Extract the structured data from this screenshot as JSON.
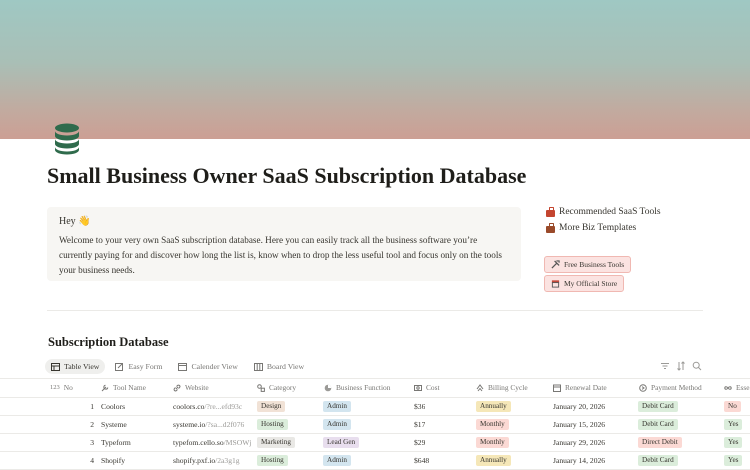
{
  "colors": {
    "tag_brown": "#f1e2d6",
    "tag_green": "#dbeddb",
    "tag_blue": "#d3e5ef",
    "tag_purple": "#e8deee",
    "tag_yellow": "#f5e7b8",
    "tag_red": "#fbd9d4",
    "tag_gray": "#e9e8e5"
  },
  "page": {
    "icon": "database-icon",
    "title": "Small Business Owner SaaS Subscription Database"
  },
  "callout": {
    "greeting": "Hey 👋",
    "body": "Welcome to your very own SaaS subscription database. Here you can easily track all the business software you’re currently paying for and discover how long the list is, know when to drop the less useful tool and focus only on the tools your business needs."
  },
  "links": [
    {
      "label": "Recommended SaaS Tools",
      "icon": "briefcase-icon"
    },
    {
      "label": "More Biz Templates",
      "icon": "briefcase-icon"
    }
  ],
  "buttons": [
    {
      "label": "Free Business Tools",
      "icon": "hammer-wrench-icon"
    },
    {
      "label": "My Official Store",
      "icon": "store-icon"
    }
  ],
  "database": {
    "title": "Subscription Database",
    "views": [
      {
        "label": "Table View",
        "icon": "table-icon",
        "active": true
      },
      {
        "label": "Easy Form",
        "icon": "pencil-icon",
        "active": false
      },
      {
        "label": "Calender View",
        "icon": "calendar-icon",
        "active": false
      },
      {
        "label": "Board View",
        "icon": "board-icon",
        "active": false
      }
    ],
    "toolbar": [
      "filter-icon",
      "sort-icon",
      "search-icon"
    ],
    "columns": [
      {
        "label": "No",
        "icon": "number-icon"
      },
      {
        "label": "Tool Name",
        "icon": "wrench-icon"
      },
      {
        "label": "Website",
        "icon": "link-icon"
      },
      {
        "label": "Category",
        "icon": "shapes-icon"
      },
      {
        "label": "Business Function",
        "icon": "pie-icon"
      },
      {
        "label": "Cost",
        "icon": "money-icon"
      },
      {
        "label": "Billing Cycle",
        "icon": "cycle-icon"
      },
      {
        "label": "Renewal Date",
        "icon": "calendar-icon"
      },
      {
        "label": "Payment Method",
        "icon": "card-icon"
      },
      {
        "label": "Esse",
        "icon": "infinity-icon"
      }
    ],
    "rows": [
      {
        "no": "1",
        "tool": "Coolors",
        "site_main": "coolors.co",
        "site_rest": "/?re...efd93c",
        "category": "Design",
        "function": "Admin",
        "cost": "$36",
        "billing": "Annually",
        "renewal": "January 20, 2026",
        "payment": "Debit Card",
        "essential": "No"
      },
      {
        "no": "2",
        "tool": "Systeme",
        "site_main": "systeme.io",
        "site_rest": "/?sa...d2f076",
        "category": "Hosting",
        "function": "Admin",
        "cost": "$17",
        "billing": "Monthly",
        "renewal": "January 15, 2026",
        "payment": "Debit Card",
        "essential": "Yes"
      },
      {
        "no": "3",
        "tool": "Typeform",
        "site_main": "typefom.cello.so",
        "site_rest": "/MSOWj",
        "category": "Marketing",
        "function": "Lead Gen",
        "cost": "$29",
        "billing": "Monthly",
        "renewal": "January 29, 2026",
        "payment": "Direct Debit",
        "essential": "Yes"
      },
      {
        "no": "4",
        "tool": "Shopify",
        "site_main": "shopify.pxf.io",
        "site_rest": "/2a3g1g",
        "category": "Hosting",
        "function": "Admin",
        "cost": "$648",
        "billing": "Annually",
        "renewal": "January 14, 2026",
        "payment": "Debit Card",
        "essential": "Yes"
      }
    ]
  }
}
